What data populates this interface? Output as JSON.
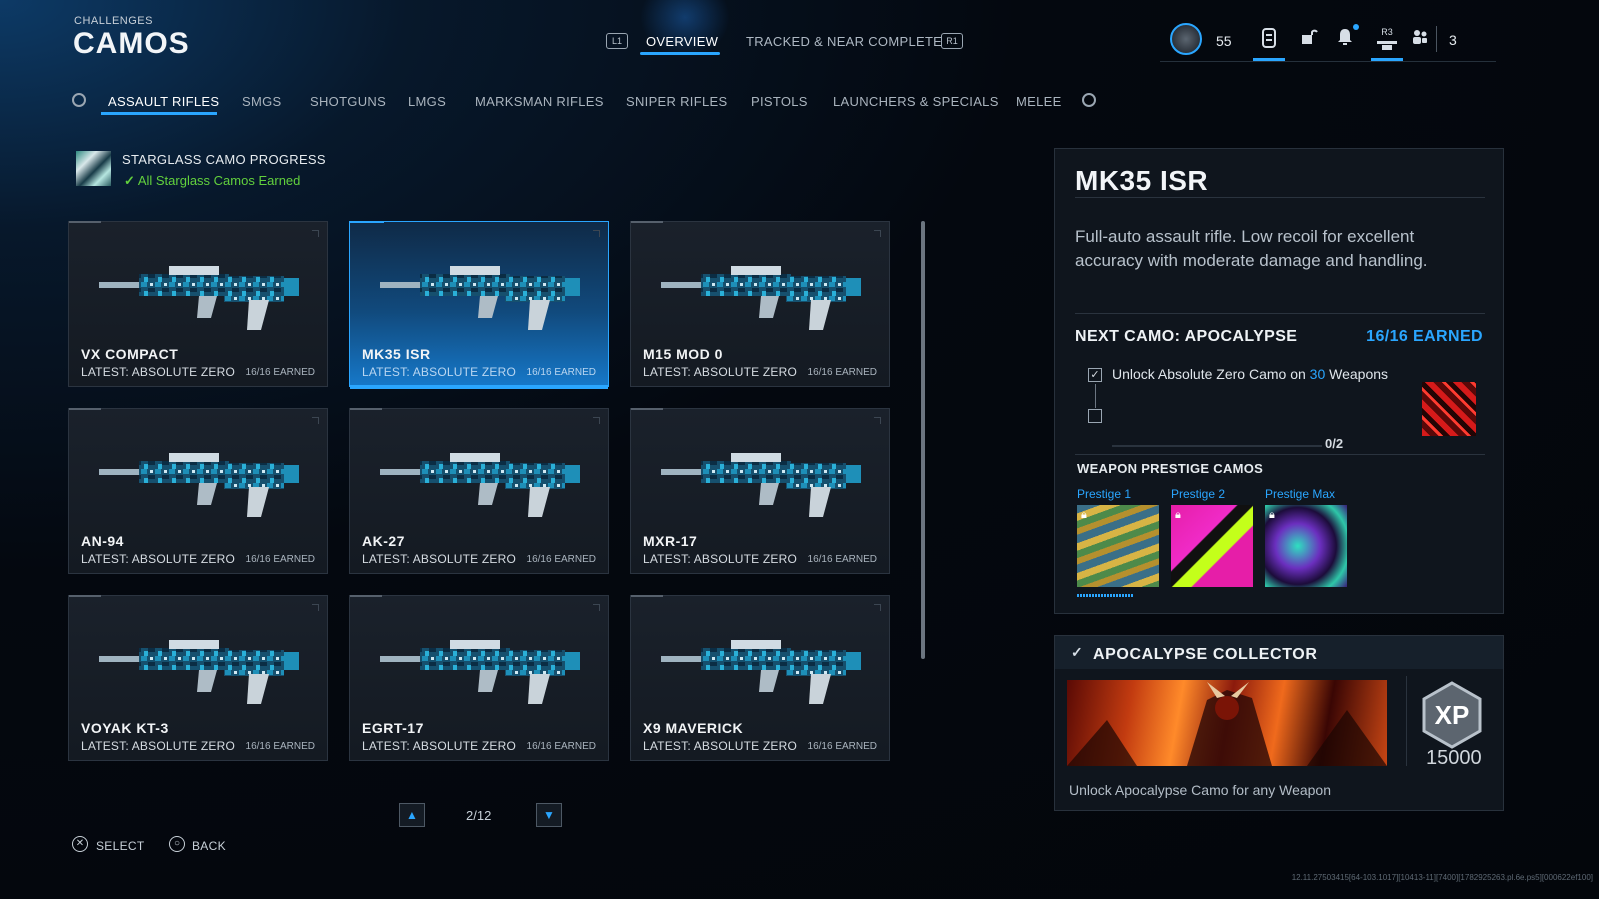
{
  "header": {
    "section": "CHALLENGES",
    "title": "CAMOS"
  },
  "top_tabs": {
    "left_bumper": "L1",
    "right_bumper": "R1",
    "overview": "OVERVIEW",
    "tracked": "TRACKED & NEAR COMPLETE"
  },
  "hud": {
    "level": "55",
    "r3": "R3",
    "party_count": "3"
  },
  "categories": [
    "ASSAULT RIFLES",
    "SMGS",
    "SHOTGUNS",
    "LMGS",
    "MARKSMAN RIFLES",
    "SNIPER RIFLES",
    "PISTOLS",
    "LAUNCHERS & SPECIALS",
    "MELEE"
  ],
  "progress": {
    "title": "STARGLASS CAMO PROGRESS",
    "status": "All Starglass Camos Earned"
  },
  "weapons": [
    {
      "name": "VX COMPACT",
      "latest": "LATEST: ABSOLUTE ZERO",
      "earned": "16/16 EARNED"
    },
    {
      "name": "MK35 ISR",
      "latest": "LATEST: ABSOLUTE ZERO",
      "earned": "16/16 EARNED"
    },
    {
      "name": "M15 MOD 0",
      "latest": "LATEST: ABSOLUTE ZERO",
      "earned": "16/16 EARNED"
    },
    {
      "name": "AN-94",
      "latest": "LATEST: ABSOLUTE ZERO",
      "earned": "16/16 EARNED"
    },
    {
      "name": "AK-27",
      "latest": "LATEST: ABSOLUTE ZERO",
      "earned": "16/16 EARNED"
    },
    {
      "name": "MXR-17",
      "latest": "LATEST: ABSOLUTE ZERO",
      "earned": "16/16 EARNED"
    },
    {
      "name": "VOYAK KT-3",
      "latest": "LATEST: ABSOLUTE ZERO",
      "earned": "16/16 EARNED"
    },
    {
      "name": "EGRT-17",
      "latest": "LATEST: ABSOLUTE ZERO",
      "earned": "16/16 EARNED"
    },
    {
      "name": "X9 MAVERICK",
      "latest": "LATEST: ABSOLUTE ZERO",
      "earned": "16/16 EARNED"
    }
  ],
  "pager": {
    "page": "2/12"
  },
  "prompts": {
    "select": "SELECT",
    "back": "BACK"
  },
  "detail": {
    "title": "MK35 ISR",
    "description": "Full-auto assault rifle. Low recoil for excellent accuracy with moderate damage and handling.",
    "next_camo": "NEXT CAMO: APOCALYPSE",
    "earned": "16/16 EARNED",
    "challenge_pre": "Unlock Absolute Zero Camo on ",
    "challenge_num": "30",
    "challenge_post": " Weapons",
    "progress": "0/2",
    "prestige_title": "WEAPON PRESTIGE CAMOS",
    "prestige": [
      "Prestige 1",
      "Prestige 2",
      "Prestige Max"
    ]
  },
  "collector": {
    "title": "APOCALYPSE COLLECTOR",
    "xp_label": "XP",
    "xp": "15000",
    "description": "Unlock Apocalypse Camo for any Weapon"
  },
  "footer": "12.11.27503415[64-103.1017][10413-11][7400][1782925263.pl.6e.ps5][000622ef100]",
  "colors": {
    "accent": "#2aa6ff",
    "success": "#62d13d"
  }
}
